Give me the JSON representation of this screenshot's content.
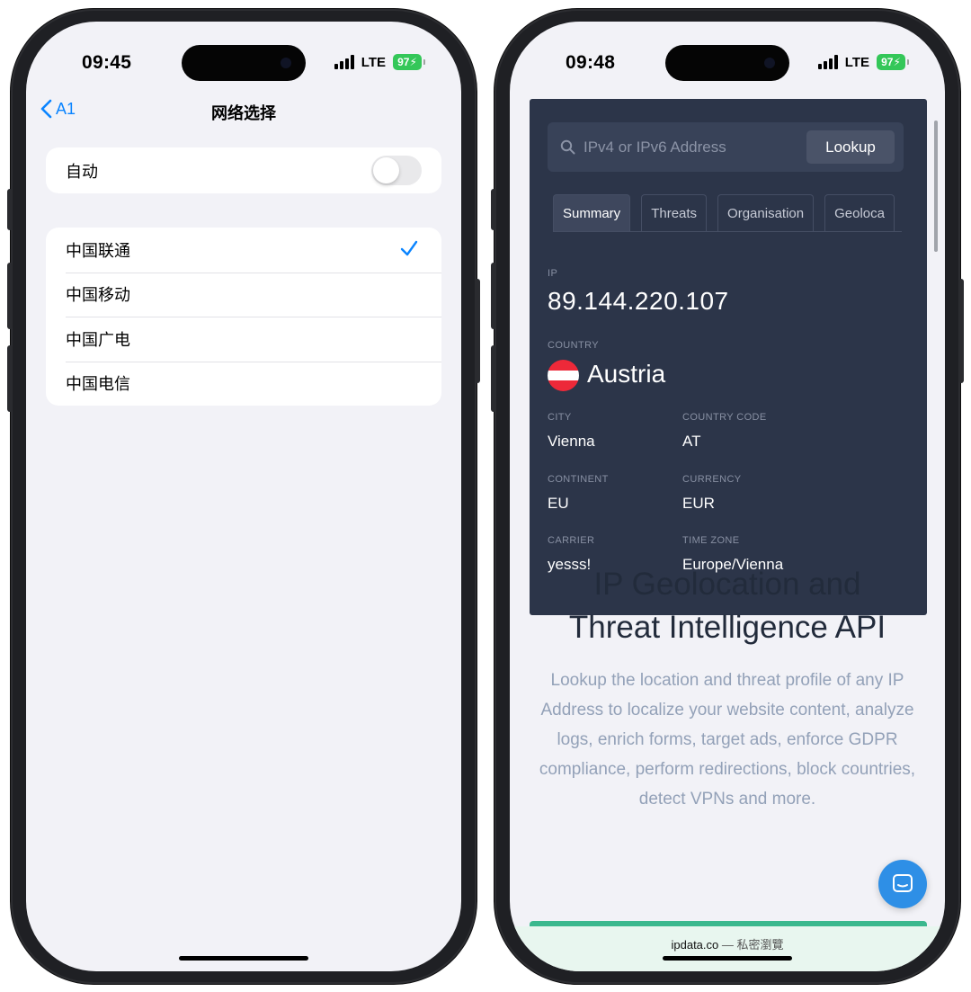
{
  "left_phone": {
    "status": {
      "time": "09:45",
      "network": "LTE",
      "battery": "97"
    },
    "nav": {
      "back_label": "A1",
      "title": "网络选择"
    },
    "auto_row": {
      "label": "自动",
      "toggle_on": false
    },
    "carriers": [
      {
        "label": "中国联通",
        "selected": true
      },
      {
        "label": "中国移动",
        "selected": false
      },
      {
        "label": "中国广电",
        "selected": false
      },
      {
        "label": "中国电信",
        "selected": false
      }
    ]
  },
  "right_phone": {
    "status": {
      "time": "09:48",
      "network": "LTE",
      "battery": "97"
    },
    "search": {
      "placeholder": "IPv4 or IPv6 Address",
      "button": "Lookup"
    },
    "tabs": [
      "Summary",
      "Threats",
      "Organisation",
      "Geoloca"
    ],
    "active_tab": "Summary",
    "ip": {
      "label": "IP",
      "value": "89.144.220.107"
    },
    "country": {
      "label": "COUNTRY",
      "value": "Austria",
      "flag_colors": [
        "#ed2939",
        "#ffffff",
        "#ed2939"
      ]
    },
    "fields": {
      "city": {
        "label": "CITY",
        "value": "Vienna"
      },
      "country_code": {
        "label": "COUNTRY CODE",
        "value": "AT"
      },
      "continent": {
        "label": "CONTINENT",
        "value": "EU"
      },
      "currency": {
        "label": "CURRENCY",
        "value": "EUR"
      },
      "carrier": {
        "label": "CARRIER",
        "value": "yesss!"
      },
      "time_zone": {
        "label": "TIME ZONE",
        "value": "Europe/Vienna"
      }
    },
    "hero": {
      "title_line1": "IP Geolocation and",
      "title_line2": "Threat Intelligence API",
      "description": "Lookup the location and threat profile of any IP Address to localize your website content, analyze logs, enrich forms, target ads, enforce GDPR compliance, perform redirections, block countries, detect VPNs and more."
    },
    "browser": {
      "domain": "ipdata.co",
      "separator": "—",
      "mode": "私密瀏覽"
    },
    "colors": {
      "card_bg": "#2c3549",
      "accent_green": "#3bb88e",
      "chat_blue": "#2e8fe6"
    }
  }
}
